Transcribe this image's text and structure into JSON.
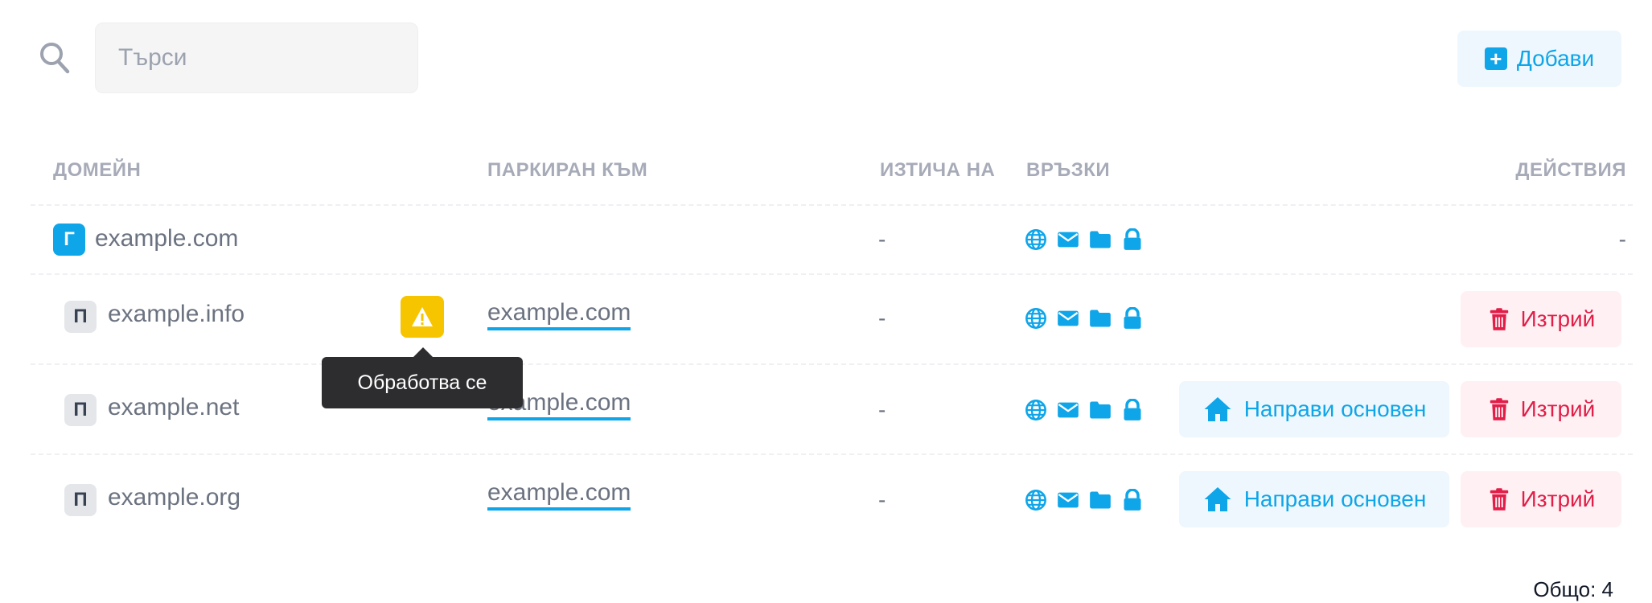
{
  "search": {
    "placeholder": "Търси"
  },
  "toolbar": {
    "add_label": "Добави"
  },
  "table": {
    "headers": {
      "domain": "ДОМЕЙН",
      "parked_to": "ПАРКИРАН КЪМ",
      "expires": "ИЗТИЧА НА",
      "links": "ВРЪЗКИ",
      "actions": "ДЕЙСТВИЯ"
    },
    "rows": [
      {
        "badge": "Г",
        "domain": "example.com",
        "parked_to": "",
        "expires": "-",
        "actions": "-"
      },
      {
        "badge": "П",
        "domain": "example.info",
        "parked_to": "example.com",
        "expires": "-",
        "delete_label": "Изтрий"
      },
      {
        "badge": "П",
        "domain": "example.net",
        "parked_to": "example.com",
        "expires": "-",
        "make_primary_label": "Направи основен",
        "delete_label": "Изтрий"
      },
      {
        "badge": "П",
        "domain": "example.org",
        "parked_to": "example.com",
        "expires": "-",
        "make_primary_label": "Направи основен",
        "delete_label": "Изтрий"
      }
    ]
  },
  "tooltip": {
    "text": "Обработва се"
  },
  "footer": {
    "total": "Общо: 4"
  },
  "icons": [
    "search-icon",
    "plus-icon",
    "globe-icon",
    "envelope-icon",
    "folder-icon",
    "lock-icon",
    "warning-icon",
    "home-icon",
    "trash-icon"
  ],
  "colors": {
    "accent": "#0ea5e9",
    "danger": "#e11d48",
    "warning": "#f7c400",
    "tooltip_bg": "#2d2d2f"
  }
}
